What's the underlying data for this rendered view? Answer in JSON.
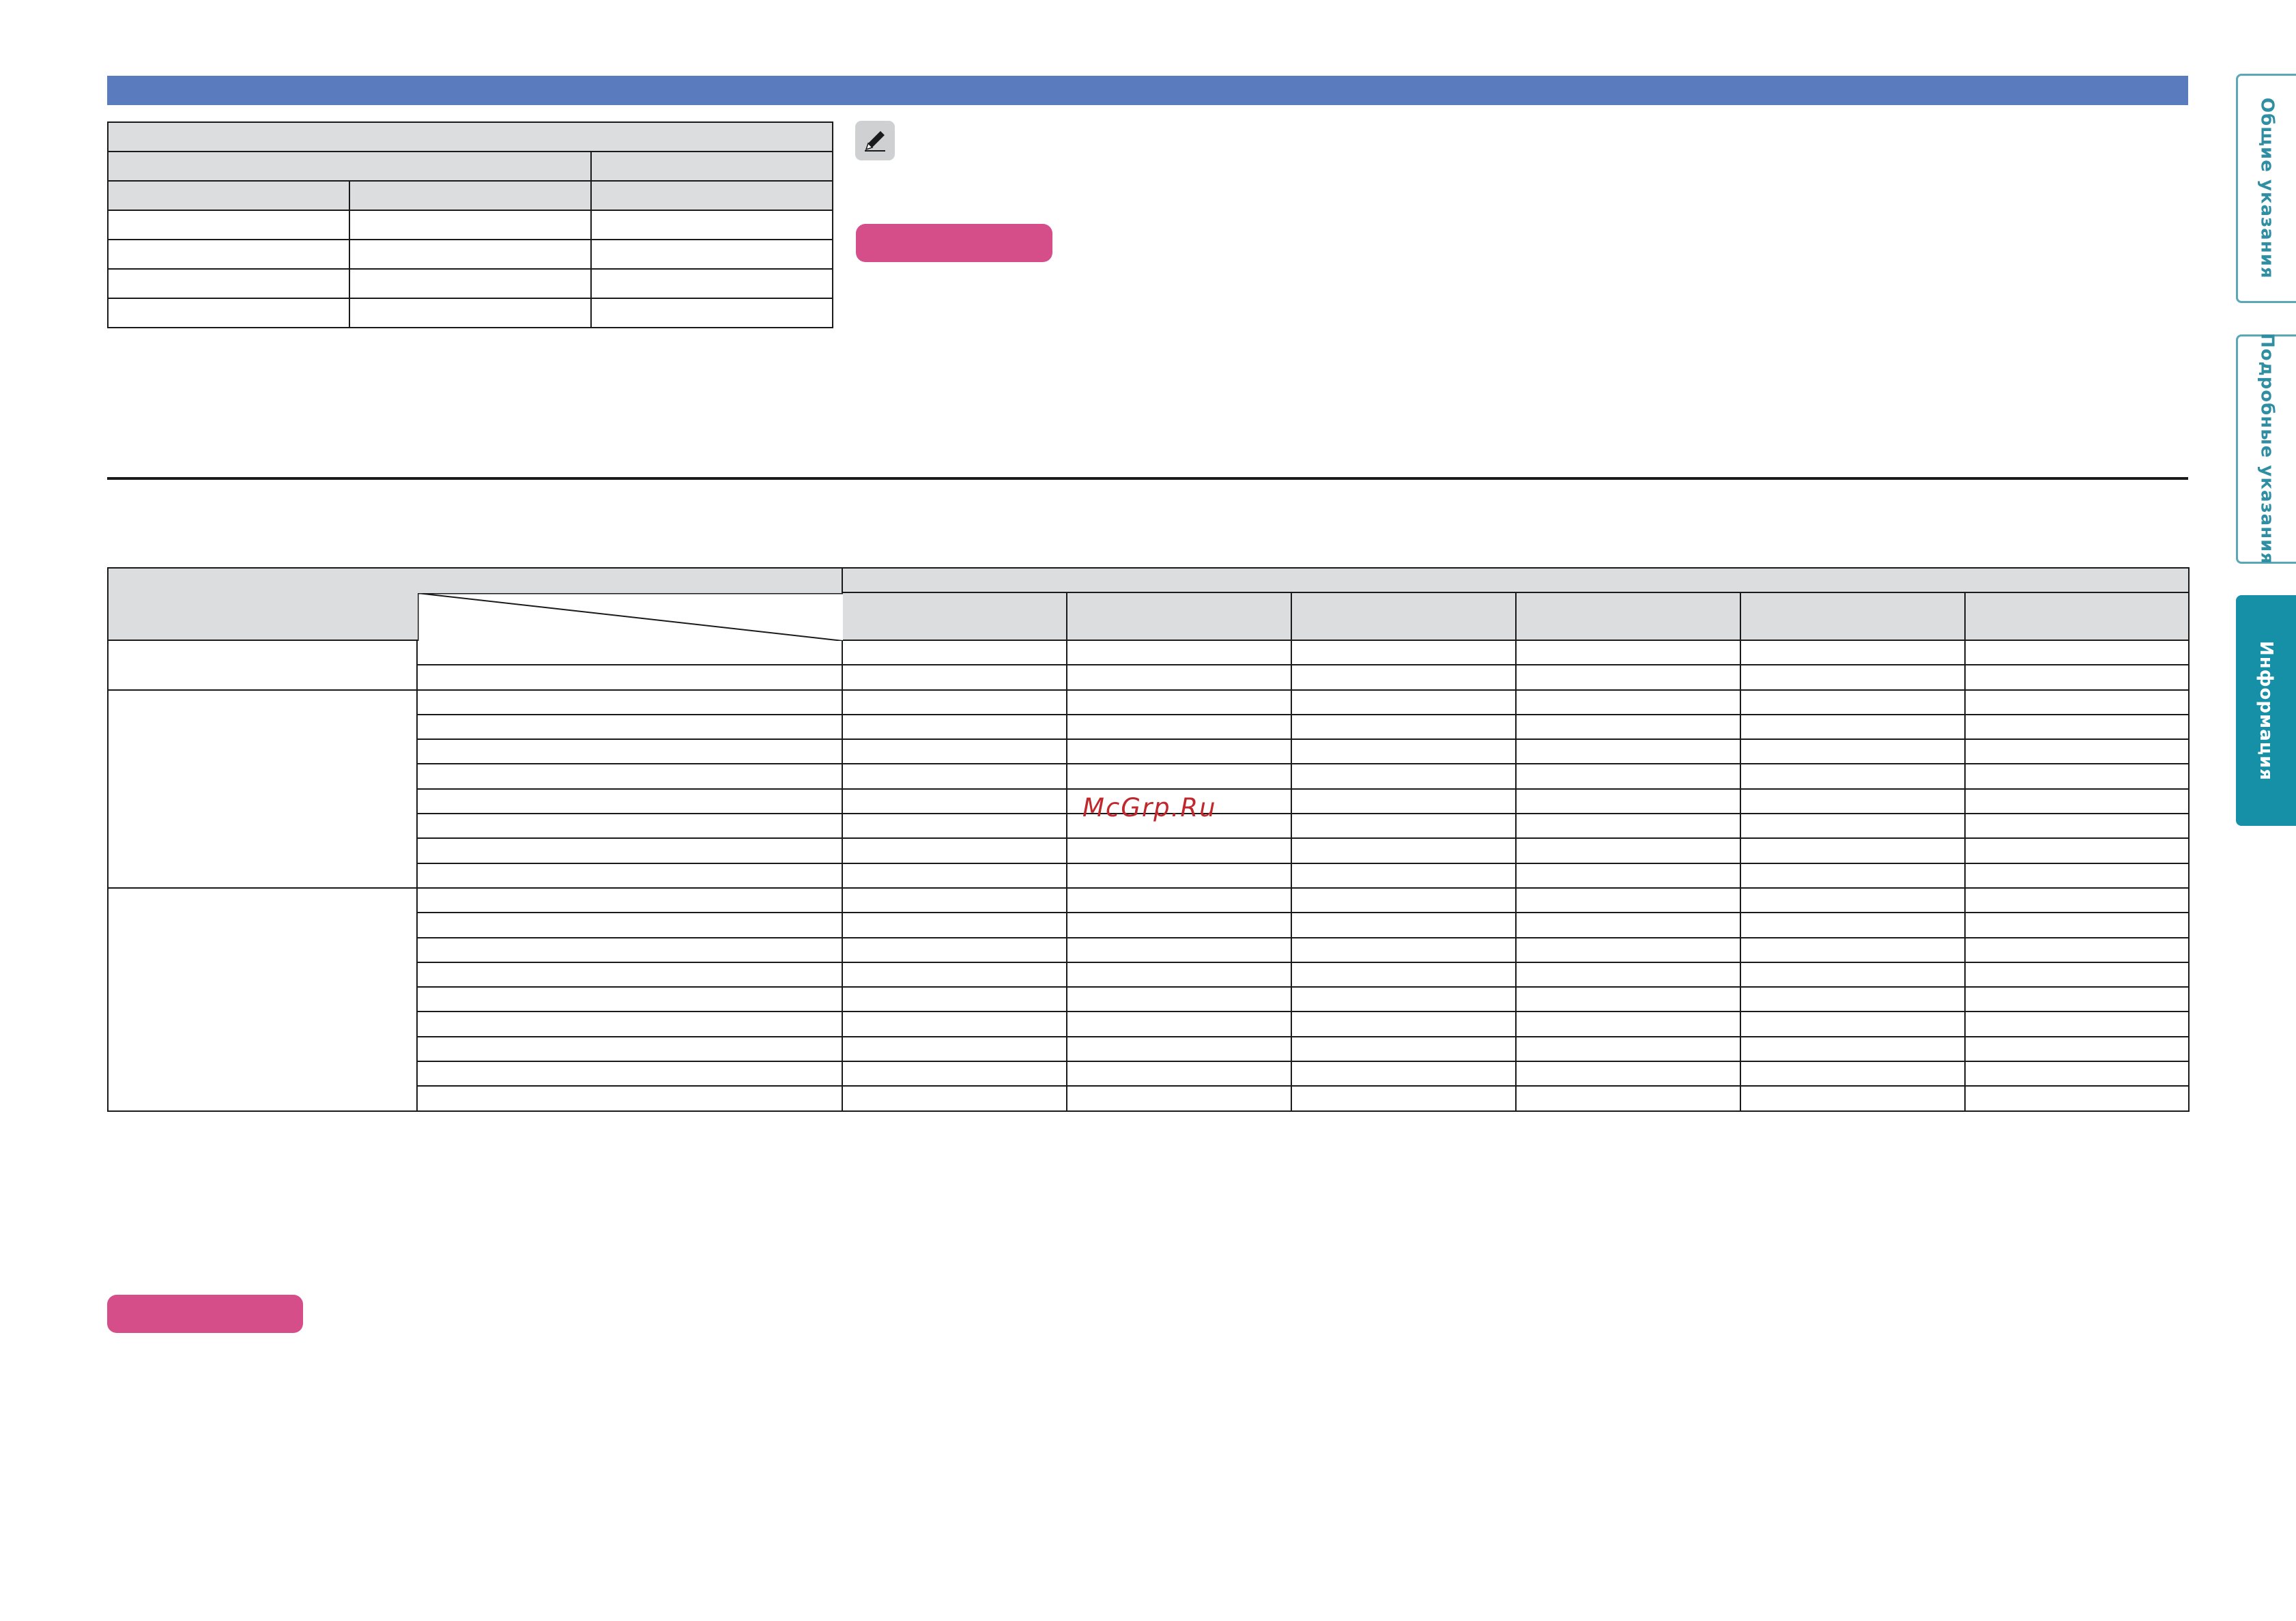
{
  "watermark": {
    "text": "McGrp.Ru"
  },
  "side_tabs": [
    {
      "label": "Общие указания",
      "active": false
    },
    {
      "label": "Подробные указания",
      "active": false
    },
    {
      "label": "Информация",
      "active": true
    }
  ],
  "colors": {
    "header_bar": "#5b7bbf",
    "pill": "#d54e89",
    "tab_active": "#1690a6",
    "tab_inactive_text": "#2f8ea2",
    "table_header_fill": "#dcdddf"
  },
  "icons": {
    "note": "pencil-icon"
  }
}
